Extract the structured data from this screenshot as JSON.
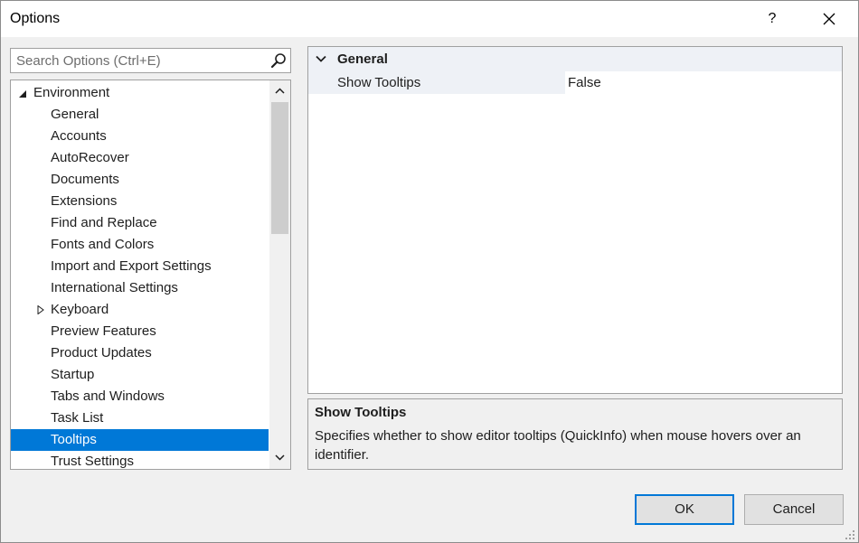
{
  "window": {
    "title": "Options",
    "help_label": "?"
  },
  "search": {
    "placeholder": "Search Options (Ctrl+E)",
    "value": ""
  },
  "tree": {
    "root_label": "Environment",
    "items": [
      {
        "label": "General"
      },
      {
        "label": "Accounts"
      },
      {
        "label": "AutoRecover"
      },
      {
        "label": "Documents"
      },
      {
        "label": "Extensions"
      },
      {
        "label": "Find and Replace"
      },
      {
        "label": "Fonts and Colors"
      },
      {
        "label": "Import and Export Settings"
      },
      {
        "label": "International Settings"
      },
      {
        "label": "Keyboard"
      },
      {
        "label": "Preview Features"
      },
      {
        "label": "Product Updates"
      },
      {
        "label": "Startup"
      },
      {
        "label": "Tabs and Windows"
      },
      {
        "label": "Task List"
      },
      {
        "label": "Tooltips"
      },
      {
        "label": "Trust Settings"
      }
    ],
    "selected": "Tooltips"
  },
  "grid": {
    "category": "General",
    "property_name": "Show Tooltips",
    "property_value": "False"
  },
  "description": {
    "title": "Show Tooltips",
    "text": "Specifies whether to show editor tooltips (QuickInfo) when mouse hovers over an identifier."
  },
  "buttons": {
    "ok": "OK",
    "cancel": "Cancel"
  },
  "colors": {
    "selection": "#0078d7",
    "category_bg": "#eef1f6",
    "dialog_bg": "#f0f0f0"
  }
}
